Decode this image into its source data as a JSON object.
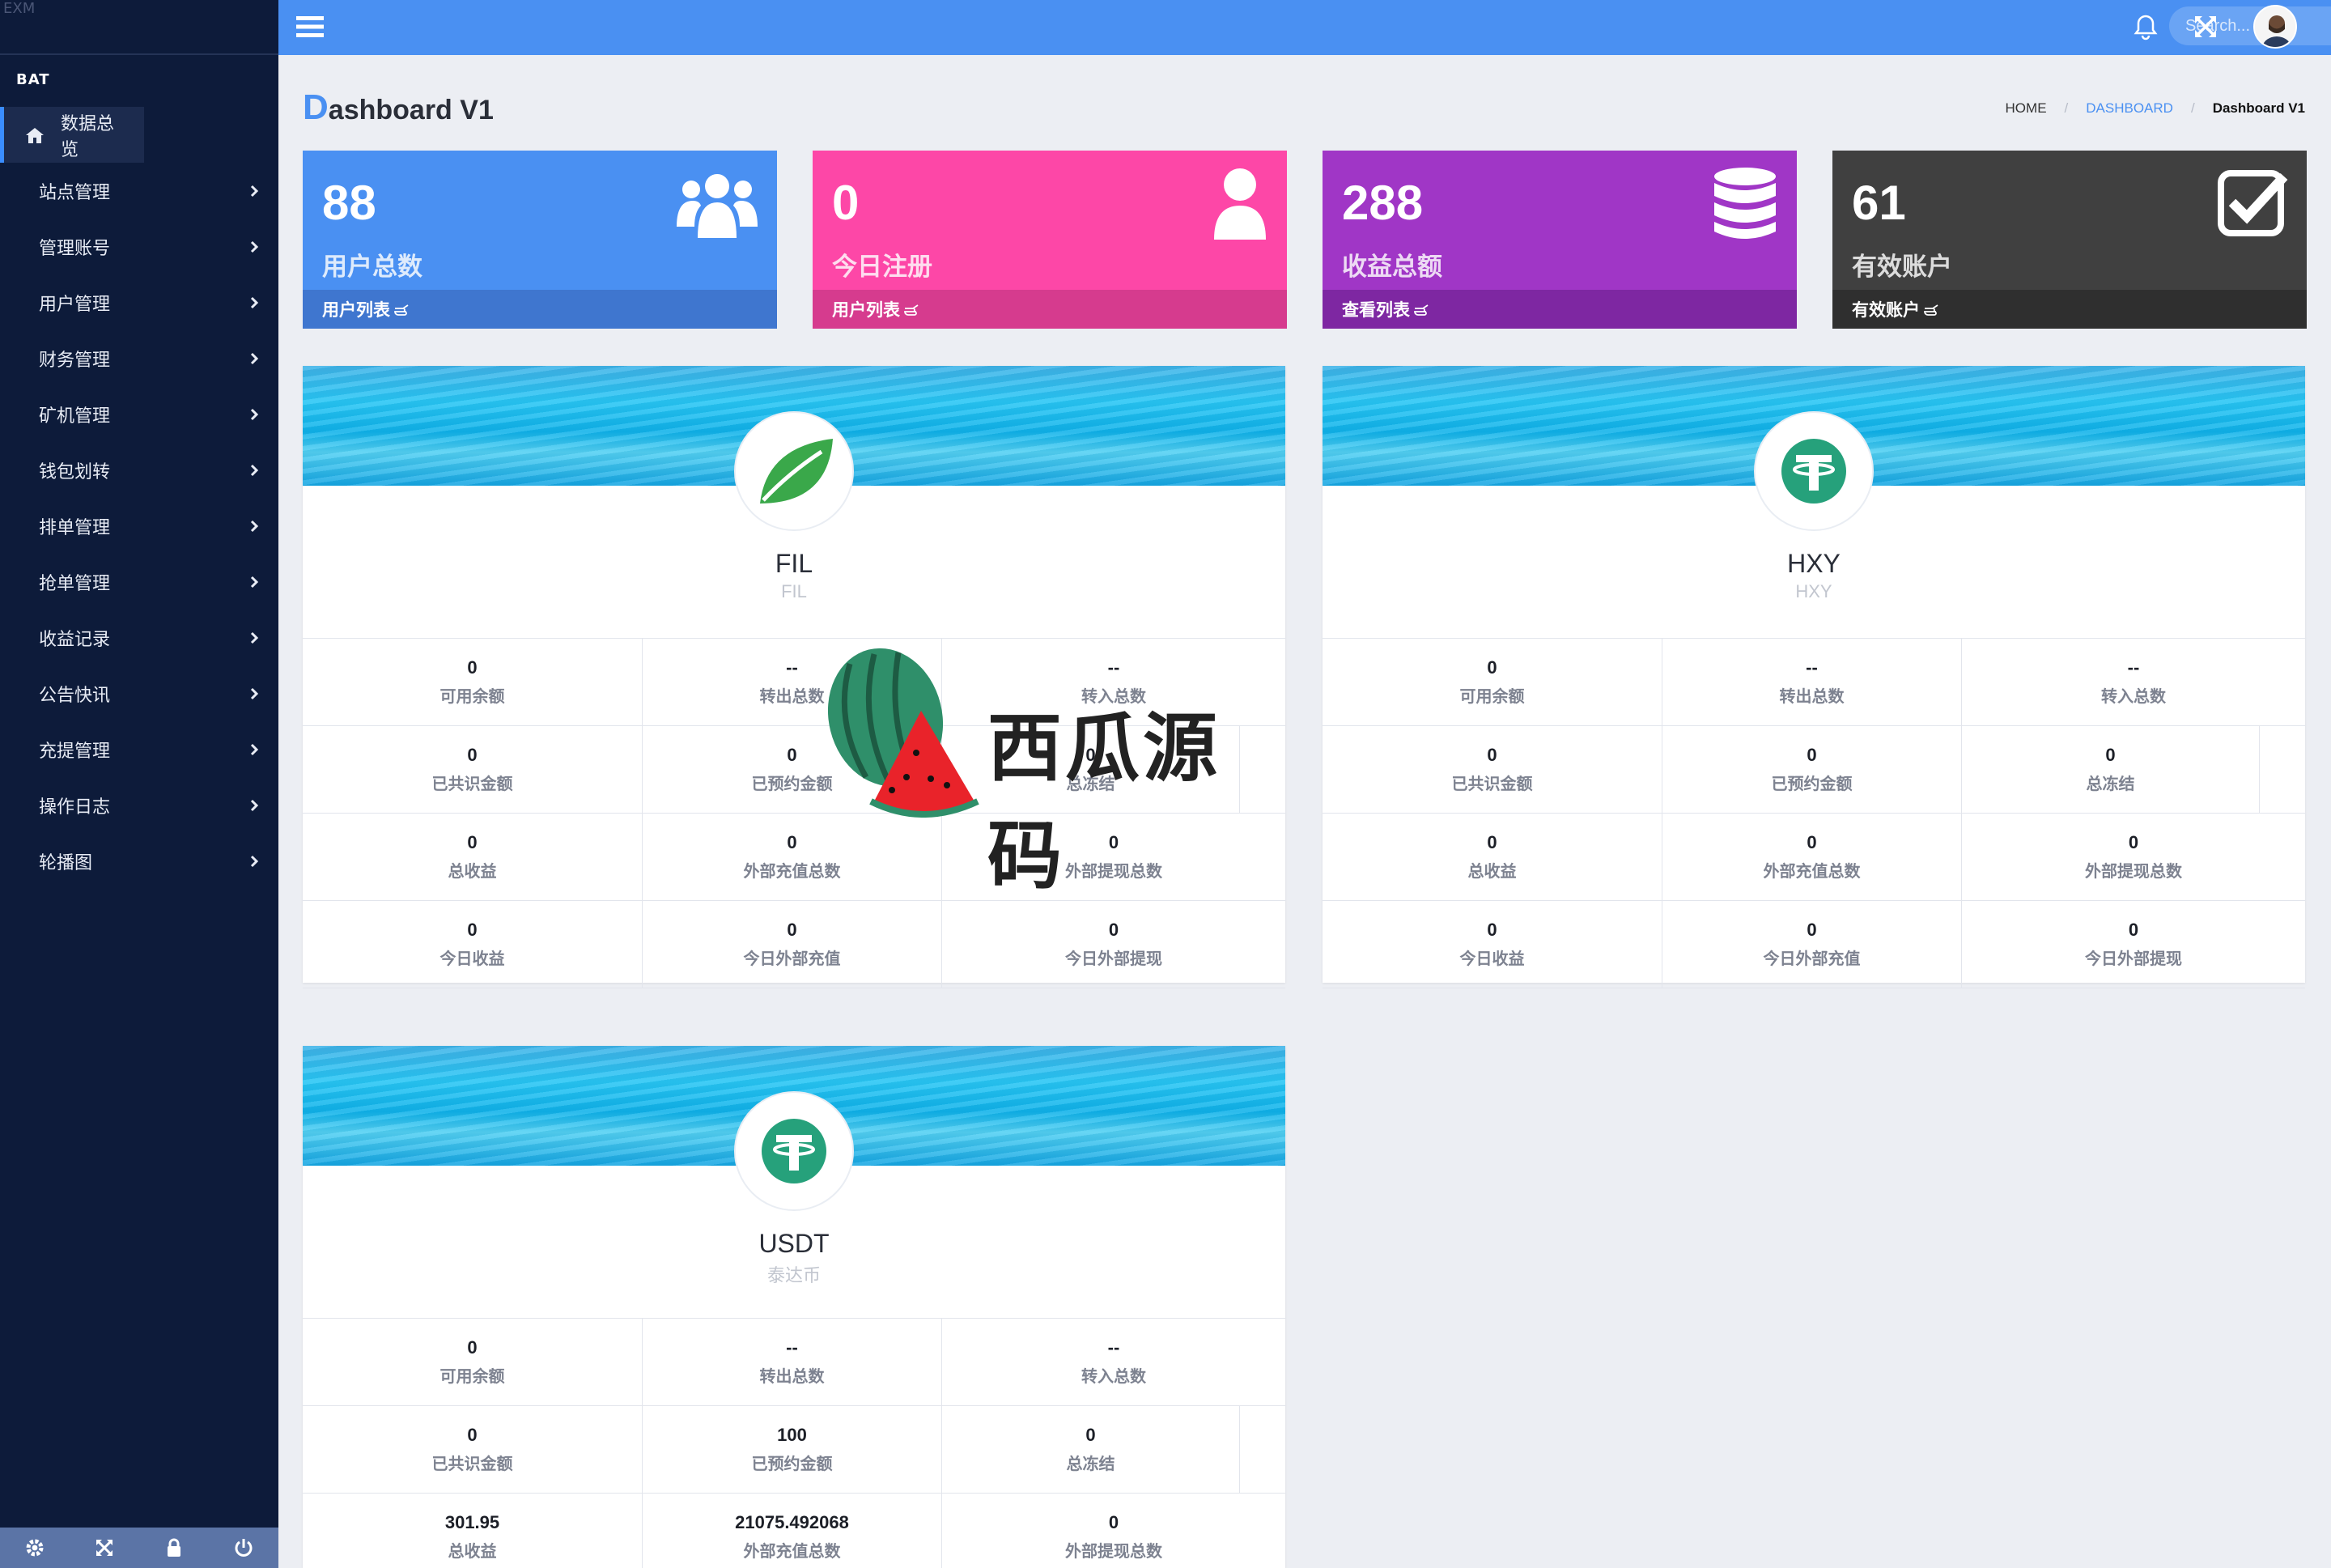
{
  "sidebar": {
    "top_text": "EXM",
    "brand": "BAT",
    "items": [
      {
        "label": "数据总览"
      },
      {
        "label": "站点管理"
      },
      {
        "label": "管理账号"
      },
      {
        "label": "用户管理"
      },
      {
        "label": "财务管理"
      },
      {
        "label": "矿机管理"
      },
      {
        "label": "钱包划转"
      },
      {
        "label": "排单管理"
      },
      {
        "label": "抢单管理"
      },
      {
        "label": "收益记录"
      },
      {
        "label": "公告快讯"
      },
      {
        "label": "充提管理"
      },
      {
        "label": "操作日志"
      },
      {
        "label": "轮播图"
      }
    ],
    "footer_icons": [
      "gear-icon",
      "fullscreen-icon",
      "lock-icon",
      "power-icon"
    ]
  },
  "topbar": {
    "search_placeholder": "Search...",
    "icons": [
      "menu-icon",
      "bell-icon",
      "fullscreen-icon",
      "avatar"
    ]
  },
  "header": {
    "title_first": "D",
    "title_rest": "ashboard V1",
    "breadcrumb": {
      "home": "HOME",
      "link": "DASHBOARD",
      "current": "Dashboard V1"
    }
  },
  "stats": [
    {
      "value": "88",
      "title": "用户总数",
      "footer": "用户列表",
      "color": "#4a90f2",
      "foot_color": "#3f76cf",
      "icon": "users-icon"
    },
    {
      "value": "0",
      "title": "今日注册",
      "footer": "用户列表",
      "color": "#fd47a7",
      "foot_color": "#d63b8e",
      "icon": "user-icon"
    },
    {
      "value": "288",
      "title": "收益总额",
      "footer": "查看列表",
      "color": "#a036c6",
      "foot_color": "#7e27a2",
      "icon": "database-icon"
    },
    {
      "value": "61",
      "title": "有效账户",
      "footer": "有效账户",
      "color": "#404040",
      "foot_color": "#2f2f2f",
      "icon": "checkbox-icon"
    }
  ],
  "coins": [
    {
      "name": "FIL",
      "sub": "FIL",
      "icon": "leaf-icon",
      "rows": [
        [
          {
            "v": "0",
            "l": "可用余额"
          },
          {
            "v": "--",
            "l": "转出总数"
          },
          {
            "v": "--",
            "l": "转入总数"
          }
        ],
        [
          {
            "v": "0",
            "l": "已共识金额"
          },
          {
            "v": "0",
            "l": "已预约金额"
          },
          {
            "v": "0",
            "l": "总冻结"
          }
        ],
        [
          {
            "v": "0",
            "l": "总收益"
          },
          {
            "v": "0",
            "l": "外部充值总数"
          },
          {
            "v": "0",
            "l": "外部提现总数"
          }
        ],
        [
          {
            "v": "0",
            "l": "今日收益"
          },
          {
            "v": "0",
            "l": "今日外部充值"
          },
          {
            "v": "0",
            "l": "今日外部提现"
          }
        ]
      ]
    },
    {
      "name": "HXY",
      "sub": "HXY",
      "icon": "tether-icon",
      "rows": [
        [
          {
            "v": "0",
            "l": "可用余额"
          },
          {
            "v": "--",
            "l": "转出总数"
          },
          {
            "v": "--",
            "l": "转入总数"
          }
        ],
        [
          {
            "v": "0",
            "l": "已共识金额"
          },
          {
            "v": "0",
            "l": "已预约金额"
          },
          {
            "v": "0",
            "l": "总冻结"
          }
        ],
        [
          {
            "v": "0",
            "l": "总收益"
          },
          {
            "v": "0",
            "l": "外部充值总数"
          },
          {
            "v": "0",
            "l": "外部提现总数"
          }
        ],
        [
          {
            "v": "0",
            "l": "今日收益"
          },
          {
            "v": "0",
            "l": "今日外部充值"
          },
          {
            "v": "0",
            "l": "今日外部提现"
          }
        ]
      ]
    },
    {
      "name": "USDT",
      "sub": "泰达币",
      "icon": "tether-icon",
      "rows": [
        [
          {
            "v": "0",
            "l": "可用余额"
          },
          {
            "v": "--",
            "l": "转出总数"
          },
          {
            "v": "--",
            "l": "转入总数"
          }
        ],
        [
          {
            "v": "0",
            "l": "已共识金额"
          },
          {
            "v": "100",
            "l": "已预约金额"
          },
          {
            "v": "0",
            "l": "总冻结"
          }
        ],
        [
          {
            "v": "301.95",
            "l": "总收益"
          },
          {
            "v": "21075.492068",
            "l": "外部充值总数"
          },
          {
            "v": "0",
            "l": "外部提现总数"
          }
        ]
      ]
    }
  ],
  "watermark": {
    "text": "西瓜源码"
  }
}
